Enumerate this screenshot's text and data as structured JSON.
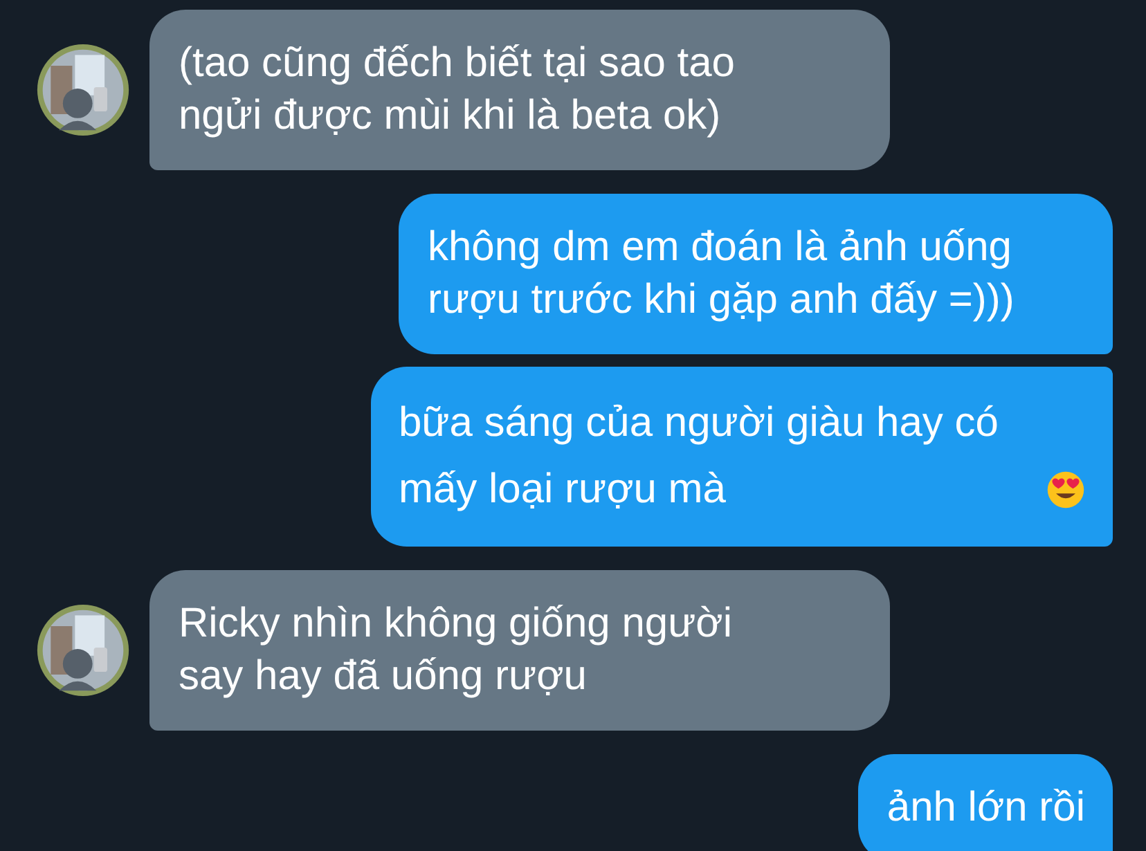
{
  "messages": [
    {
      "kind": "incoming",
      "text": "(tao cũng đếch biết tại sao tao ngửi được mùi khi là beta ok)",
      "emoji": false
    },
    {
      "kind": "outgoing",
      "text": "không dm em đoán là ảnh uống rượu trước khi gặp anh đấy =)))",
      "emoji": false
    },
    {
      "kind": "outgoing",
      "text": "bữa sáng của người giàu hay có mấy loại rượu mà",
      "emoji": true
    },
    {
      "kind": "incoming",
      "text": "Ricky nhìn không giống người say hay đã uống rượu",
      "emoji": false
    },
    {
      "kind": "outgoing",
      "text": "ảnh lớn rồi",
      "emoji": false
    }
  ]
}
